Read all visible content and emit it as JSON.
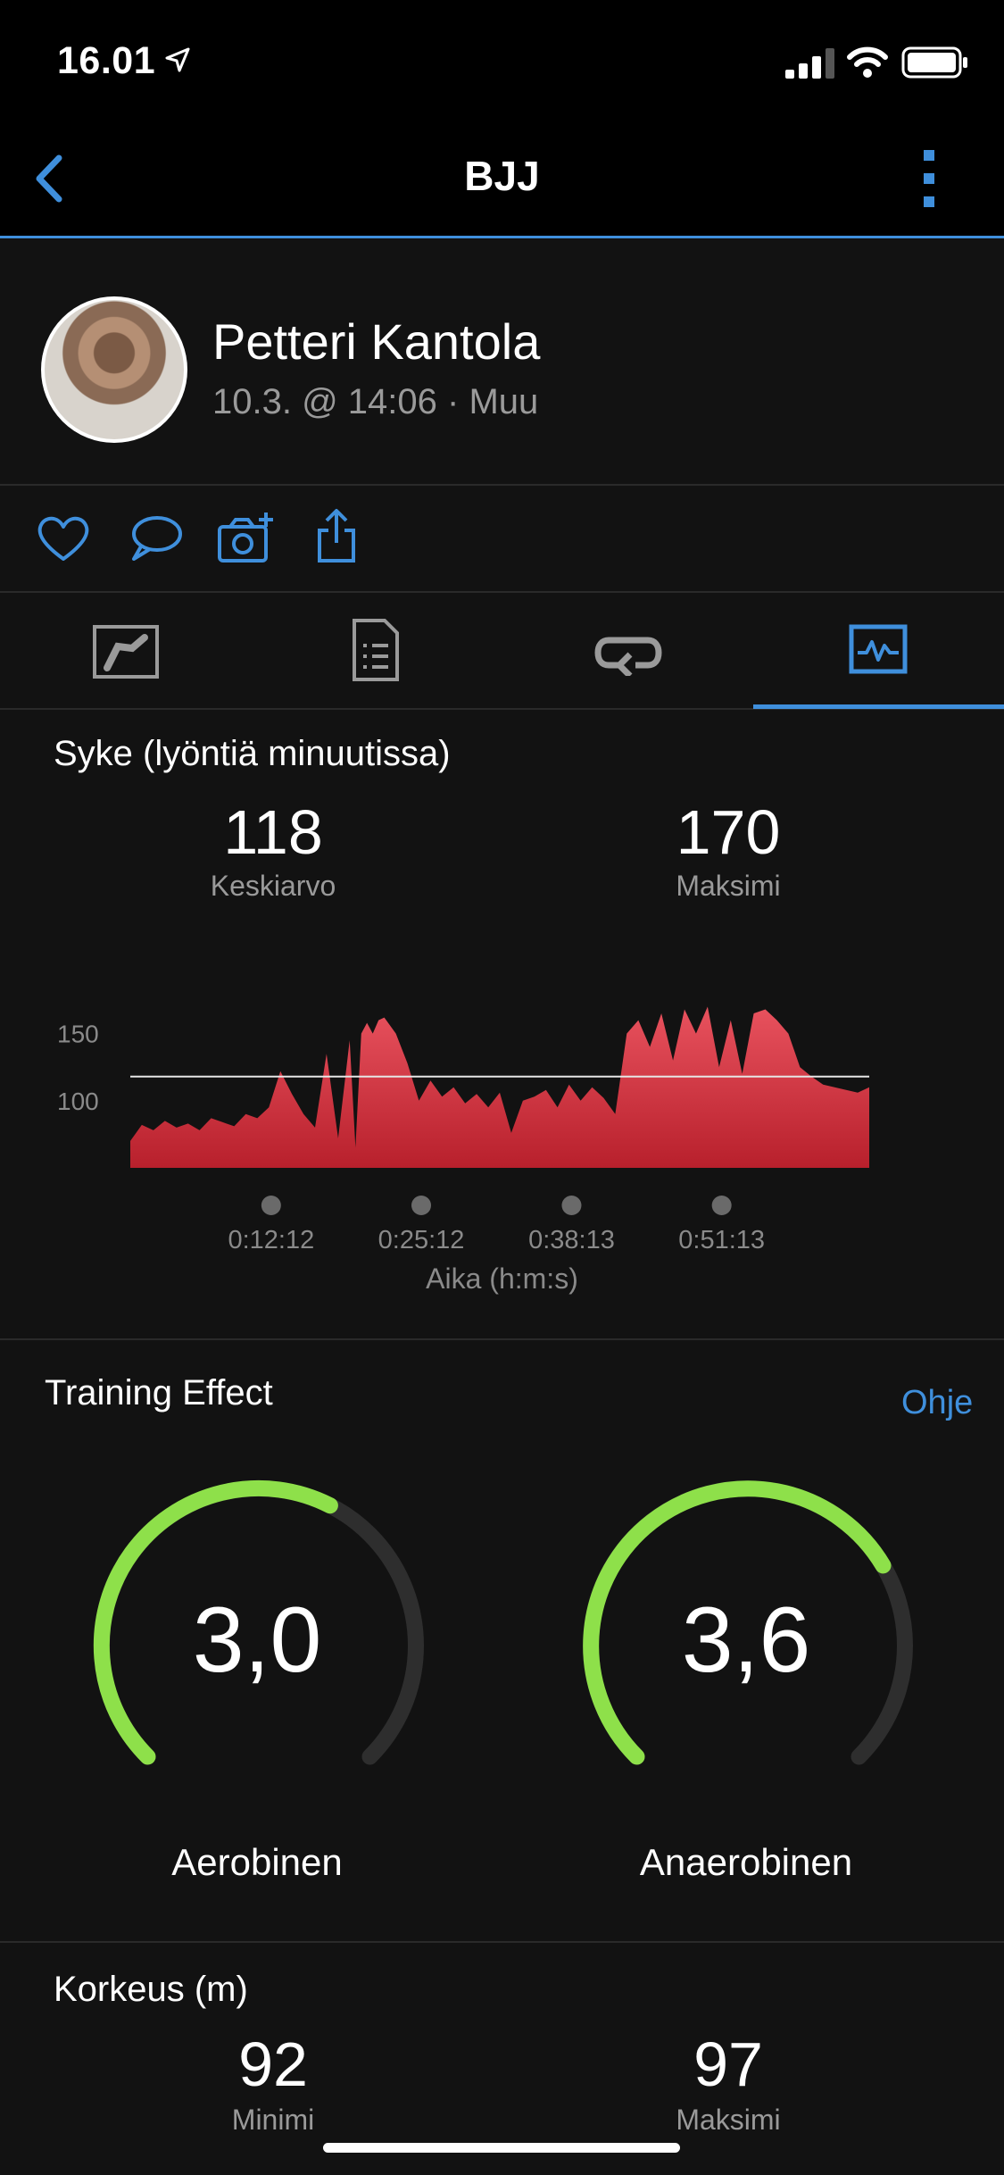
{
  "status_bar": {
    "time": "16.01"
  },
  "nav": {
    "title": "BJJ"
  },
  "profile": {
    "name": "Petteri Kantola",
    "meta": "10.3. @ 14:06 · Muu"
  },
  "actions": [
    "heart-icon",
    "comment-icon",
    "add-photo-icon",
    "share-icon"
  ],
  "tabs": [
    "map-icon",
    "details-icon",
    "laps-icon",
    "charts-icon"
  ],
  "heart_rate": {
    "title": "Syke (lyöntiä minuutissa)",
    "avg_value": "118",
    "avg_label": "Keskiarvo",
    "max_value": "170",
    "max_label": "Maksimi",
    "x_title": "Aika (h:m:s)"
  },
  "chart_data": {
    "type": "area",
    "title": "Syke (lyöntiä minuutissa)",
    "xlabel": "Aika (h:m:s)",
    "ylabel": "",
    "ylim": [
      50,
      175
    ],
    "yticks": [
      "150",
      "100"
    ],
    "xticks": [
      "0:12:12",
      "0:25:12",
      "0:38:13",
      "0:51:13"
    ],
    "average_line": 118,
    "color": "#e0434f",
    "series": [
      {
        "x_minutes": [
          0,
          1,
          2,
          3,
          4,
          5,
          6,
          7,
          8,
          9,
          10,
          11,
          12,
          13,
          14,
          15,
          16,
          17,
          18,
          19,
          19.5,
          20,
          20.5,
          21,
          21.5,
          22,
          23,
          24,
          25,
          26,
          27,
          28,
          29,
          30,
          31,
          32,
          33,
          34,
          35,
          36,
          37,
          38,
          39,
          40,
          41,
          42,
          43,
          44,
          45,
          46,
          47,
          48,
          49,
          50,
          51,
          52,
          53,
          54,
          55,
          56,
          57,
          58,
          59,
          60,
          61,
          62,
          63,
          64
        ],
        "values": [
          70,
          82,
          78,
          85,
          80,
          83,
          78,
          87,
          84,
          81,
          90,
          87,
          95,
          122,
          105,
          90,
          80,
          135,
          72,
          145,
          65,
          150,
          158,
          150,
          160,
          162,
          150,
          128,
          100,
          115,
          103,
          110,
          98,
          105,
          95,
          106,
          76,
          100,
          103,
          108,
          95,
          112,
          100,
          110,
          102,
          90,
          150,
          160,
          140,
          165,
          130,
          168,
          150,
          170,
          125,
          160,
          120,
          165,
          168,
          160,
          150,
          125,
          118,
          112,
          110,
          108,
          106,
          110,
          105,
          115
        ]
      }
    ]
  },
  "training_effect": {
    "title": "Training Effect",
    "help": "Ohje",
    "aerobic_value": "3,0",
    "aerobic_label": "Aerobinen",
    "aerobic_fraction": 0.6,
    "anaerobic_value": "3,6",
    "anaerobic_label": "Anaerobinen",
    "anaerobic_fraction": 0.72,
    "gauge_color": "#8ee04a",
    "track_color": "#2e2e2e"
  },
  "elevation": {
    "title": "Korkeus (m)",
    "min_value": "92",
    "min_label": "Minimi",
    "max_value": "97",
    "max_label": "Maksimi"
  }
}
